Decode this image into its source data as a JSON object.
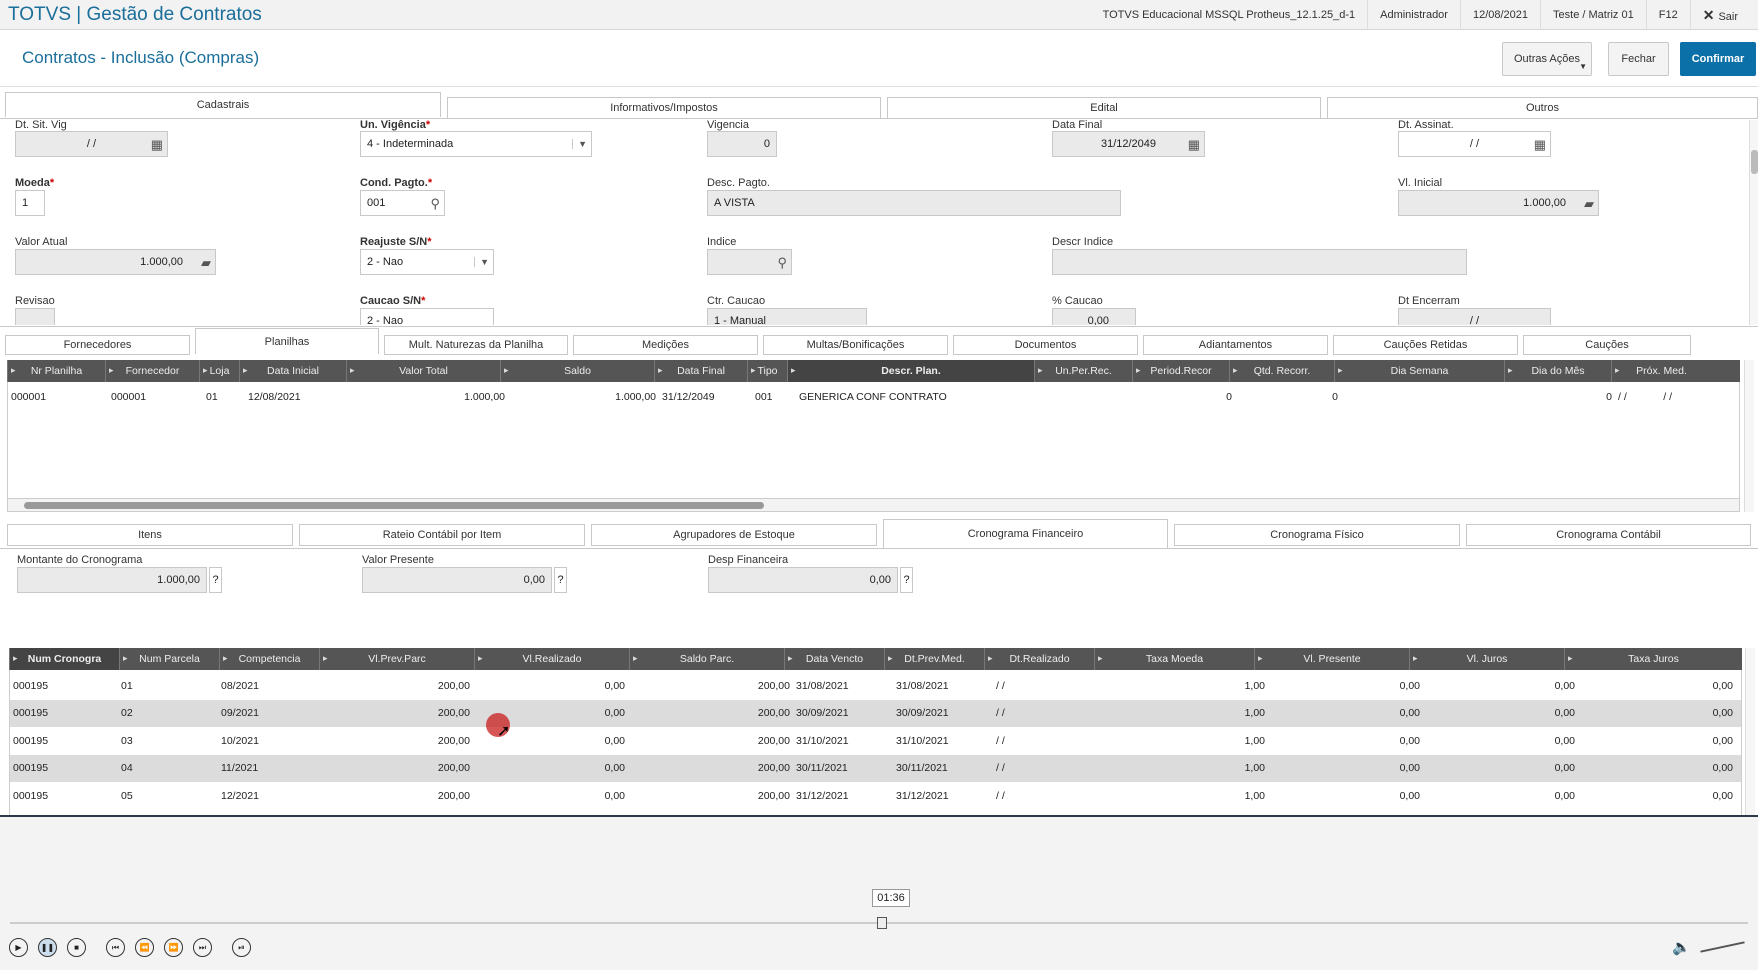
{
  "app": {
    "title": "TOTVS | Gestão de Contratos"
  },
  "sysinfo": {
    "environment": "TOTVS Educacional MSSQL Protheus_12.1.25_d-1",
    "user": "Administrador",
    "date": "12/08/2021",
    "branch": "Teste / Matriz 01",
    "key": "F12",
    "exit": "Sair"
  },
  "page": {
    "title": "Contratos - Inclusão (Compras)"
  },
  "actions": {
    "more": "Outras Ações",
    "close": "Fechar",
    "confirm": "Confirmar"
  },
  "top_tabs": [
    "Cadastrais",
    "Informativos/Impostos",
    "Edital",
    "Outros"
  ],
  "fields": {
    "dt_sit_vig": {
      "label": "Dt. Sit. Vig",
      "value": "/ /"
    },
    "un_vigencia": {
      "label": "Un. Vigência",
      "value": "4 - Indeterminada"
    },
    "vigencia": {
      "label": "Vigencia",
      "value": "0"
    },
    "data_final": {
      "label": "Data Final",
      "value": "31/12/2049"
    },
    "dt_assinat": {
      "label": "Dt. Assinat.",
      "value": "/ /"
    },
    "moeda": {
      "label": "Moeda",
      "value": "1"
    },
    "cond_pagto": {
      "label": "Cond. Pagto.",
      "value": "001"
    },
    "desc_pagto": {
      "label": "Desc. Pagto.",
      "value": "A VISTA"
    },
    "vl_inicial": {
      "label": "Vl. Inicial",
      "value": "1.000,00"
    },
    "valor_atual": {
      "label": "Valor Atual",
      "value": "1.000,00"
    },
    "reajuste": {
      "label": "Reajuste S/N",
      "value": "2 - Nao"
    },
    "indice": {
      "label": "Indice",
      "value": ""
    },
    "descr_indice": {
      "label": "Descr Indice",
      "value": ""
    },
    "revisao": {
      "label": "Revisao",
      "value": ""
    },
    "caucao": {
      "label": "Caucao S/N",
      "value": "2 - Nao"
    },
    "ctr_caucao": {
      "label": "Ctr. Caucao",
      "value": "1 - Manual"
    },
    "pct_caucao": {
      "label": "% Caucao",
      "value": "0,00"
    },
    "dt_encerram": {
      "label": "Dt Encerram",
      "value": "/ /"
    }
  },
  "mid_tabs": [
    "Fornecedores",
    "Planilhas",
    "Mult. Naturezas da Planilha",
    "Medições",
    "Multas/Bonificações",
    "Documentos",
    "Adiantamentos",
    "Cauções Retidas",
    "Cauções"
  ],
  "planilhas": {
    "columns": [
      "Nr Planilha",
      "Fornecedor",
      "Loja",
      "Data Inicial",
      "Valor Total",
      "Saldo",
      "Data Final",
      "Tipo",
      "Descr. Plan.",
      "Un.Per.Rec.",
      "Period.Recor",
      "Qtd. Recorr.",
      "Dia Semana",
      "Dia do Mês",
      "Próx. Med."
    ],
    "rows": [
      [
        "000001",
        "000001",
        "01",
        "12/08/2021",
        "1.000,00",
        "1.000,00",
        "31/12/2049",
        "001",
        "GENERICA CONF CONTRATO",
        "",
        "0",
        "0",
        "",
        "0",
        "/ /",
        "/ /"
      ]
    ]
  },
  "bottom_tabs": [
    "Itens",
    "Rateio Contábil por Item",
    "Agrupadores de Estoque",
    "Cronograma Financeiro",
    "Cronograma Físico",
    "Cronograma Contábil"
  ],
  "summary": {
    "montante": {
      "label": "Montante do Cronograma",
      "value": "1.000,00"
    },
    "valor_presente": {
      "label": "Valor Presente",
      "value": "0,00"
    },
    "desp_financeira": {
      "label": "Desp Financeira",
      "value": "0,00"
    },
    "help": "?"
  },
  "cronograma": {
    "columns": [
      "Num Cronogra",
      "Num Parcela",
      "Competencia",
      "Vl.Prev.Parc",
      "Vl.Realizado",
      "Saldo Parc.",
      "Data Vencto",
      "Dt.Prev.Med.",
      "Dt.Realizado",
      "Taxa Moeda",
      "Vl. Presente",
      "Vl. Juros",
      "Taxa Juros"
    ],
    "rows": [
      [
        "000195",
        "01",
        "08/2021",
        "200,00",
        "0,00",
        "200,00",
        "31/08/2021",
        "31/08/2021",
        "/ /",
        "1,00",
        "0,00",
        "0,00",
        "0,00"
      ],
      [
        "000195",
        "02",
        "09/2021",
        "200,00",
        "0,00",
        "200,00",
        "30/09/2021",
        "30/09/2021",
        "/ /",
        "1,00",
        "0,00",
        "0,00",
        "0,00"
      ],
      [
        "000195",
        "03",
        "10/2021",
        "200,00",
        "0,00",
        "200,00",
        "31/10/2021",
        "31/10/2021",
        "/ /",
        "1,00",
        "0,00",
        "0,00",
        "0,00"
      ],
      [
        "000195",
        "04",
        "11/2021",
        "200,00",
        "0,00",
        "200,00",
        "30/11/2021",
        "30/11/2021",
        "/ /",
        "1,00",
        "0,00",
        "0,00",
        "0,00"
      ],
      [
        "000195",
        "05",
        "12/2021",
        "200,00",
        "0,00",
        "200,00",
        "31/12/2021",
        "31/12/2021",
        "/ /",
        "1,00",
        "0,00",
        "0,00",
        "0,00"
      ]
    ]
  },
  "player": {
    "time": "01:36"
  }
}
